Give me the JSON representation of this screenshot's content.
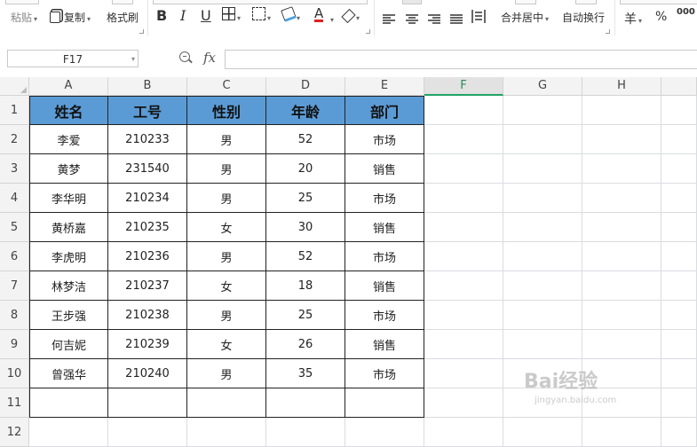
{
  "toolbar": {
    "paste_label": "粘贴",
    "copy_label": "复制",
    "format_painter_label": "格式刷",
    "bold_label": "B",
    "italic_label": "I",
    "underline_label": "U",
    "merge_center_label": "合并居中",
    "wrap_text_label": "自动换行",
    "currency_label": "羊",
    "percent_label": "%",
    "thousands_label": "000"
  },
  "formula_bar": {
    "name_box": "F17",
    "fx_label": "fx",
    "formula_value": ""
  },
  "grid": {
    "columns": [
      "A",
      "B",
      "C",
      "D",
      "E",
      "F",
      "G",
      "H"
    ],
    "selected_column": "F",
    "rows": [
      "1",
      "2",
      "3",
      "4",
      "5",
      "6",
      "7",
      "8",
      "9",
      "10",
      "11",
      "12"
    ],
    "header_row": [
      "姓名",
      "工号",
      "性别",
      "年龄",
      "部门"
    ],
    "data_rows": [
      [
        "李爱",
        "210233",
        "男",
        "52",
        "市场"
      ],
      [
        "黄梦",
        "231540",
        "男",
        "20",
        "销售"
      ],
      [
        "李华明",
        "210234",
        "男",
        "25",
        "市场"
      ],
      [
        "黄桥嘉",
        "210235",
        "女",
        "30",
        "销售"
      ],
      [
        "李虎明",
        "210236",
        "男",
        "52",
        "市场"
      ],
      [
        "林梦洁",
        "210237",
        "女",
        "18",
        "销售"
      ],
      [
        "王步强",
        "210238",
        "男",
        "25",
        "市场"
      ],
      [
        "何吉妮",
        "210239",
        "女",
        "26",
        "销售"
      ],
      [
        "曾强华",
        "210240",
        "男",
        "35",
        "市场"
      ],
      [
        "",
        "",
        "",
        "",
        ""
      ]
    ]
  },
  "watermark": {
    "brand": "Bai经验",
    "url": "jingyan.baidu.com"
  },
  "colors": {
    "header_fill": "#5b9bd5",
    "selection": "#21a366"
  }
}
